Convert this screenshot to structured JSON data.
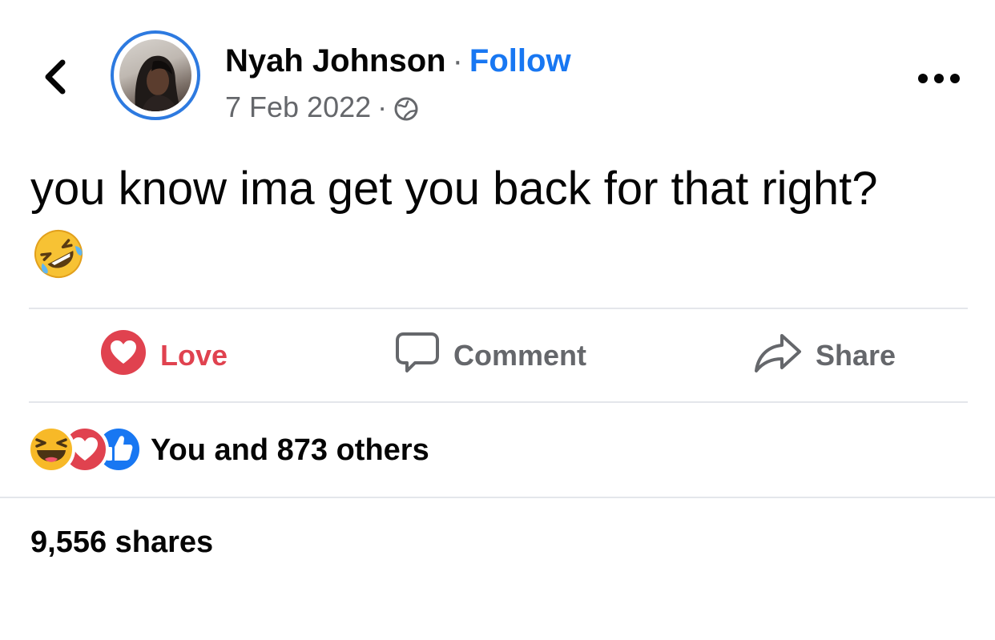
{
  "post": {
    "author_name": "Nyah Johnson",
    "separator": "·",
    "follow_label": "Follow",
    "date": "7 Feb 2022",
    "meta_separator": "·",
    "audience_icon": "globe-icon",
    "text": "you know ima get you back for that right?",
    "emoji": "rolling-on-floor-laughing-emoji"
  },
  "actions": {
    "love_label": "Love",
    "comment_label": "Comment",
    "share_label": "Share"
  },
  "reactions": {
    "icons": [
      "haha-reaction-icon",
      "love-reaction-icon",
      "like-reaction-icon"
    ],
    "summary": "You and 873 others"
  },
  "shares": {
    "label": "9,556 shares"
  },
  "colors": {
    "accent_blue": "#1877f2",
    "avatar_ring": "#2d7ae0",
    "love_red": "#e0424f",
    "secondary_text": "#65676b",
    "divider": "#e4e6eb",
    "haha_yellow": "#f7b928",
    "like_blue": "#1877f2"
  }
}
